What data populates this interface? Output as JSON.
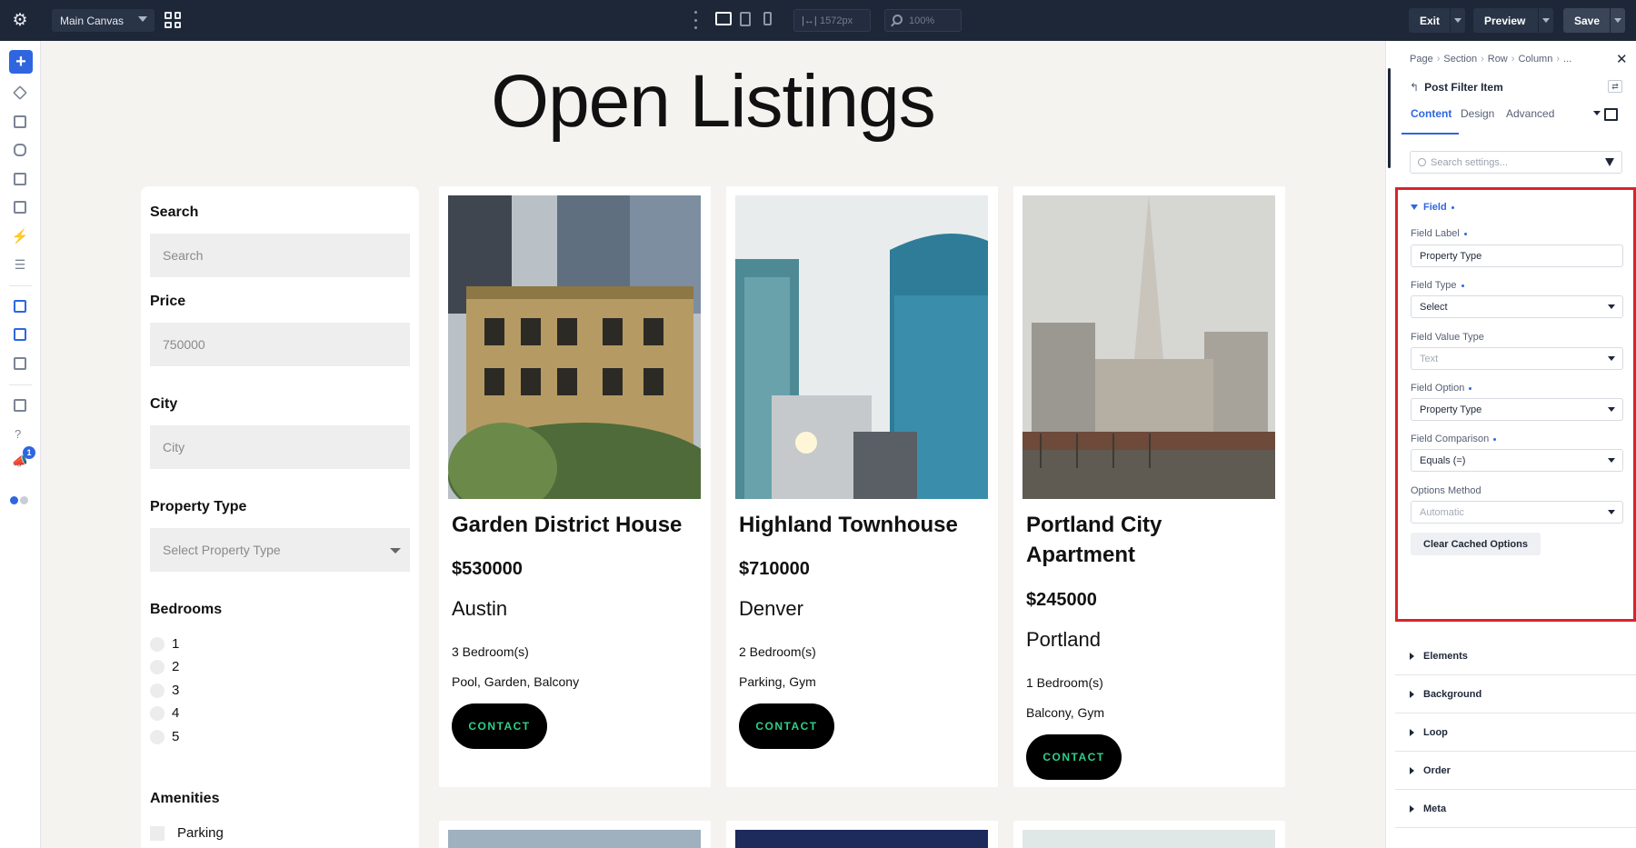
{
  "topbar": {
    "canvas_name": "Main Canvas",
    "width_value": "1572px",
    "zoom_value": "100%",
    "exit_label": "Exit",
    "preview_label": "Preview",
    "save_label": "Save"
  },
  "leftrail": {
    "badge_count": "1",
    "help_glyph": "?"
  },
  "canvas": {
    "page_title": "Open Listings",
    "filters": {
      "search_label": "Search",
      "search_placeholder": "Search",
      "price_label": "Price",
      "price_value": "750000",
      "city_label": "City",
      "city_placeholder": "City",
      "property_type_label": "Property Type",
      "property_type_placeholder": "Select Property Type",
      "bedrooms_label": "Bedrooms",
      "bedroom_options": [
        "1",
        "2",
        "3",
        "4",
        "5"
      ],
      "amenities_label": "Amenities",
      "amenity_options": [
        "Parking"
      ]
    },
    "listings": [
      {
        "name": "Garden District House",
        "price": "$530000",
        "city": "Austin",
        "bedrooms": "3 Bedroom(s)",
        "amenities": "Pool, Garden, Balcony",
        "contact_label": "CONTACT"
      },
      {
        "name": "Highland Townhouse",
        "price": "$710000",
        "city": "Denver",
        "bedrooms": "2 Bedroom(s)",
        "amenities": "Parking, Gym",
        "contact_label": "CONTACT"
      },
      {
        "name": "Portland City Apartment",
        "price": "$245000",
        "city": "Portland",
        "bedrooms": "1 Bedroom(s)",
        "amenities": "Balcony, Gym",
        "contact_label": "CONTACT"
      }
    ]
  },
  "panel": {
    "breadcrumbs": [
      "Page",
      "Section",
      "Row",
      "Column",
      "..."
    ],
    "element_title": "Post Filter Item",
    "tabs": [
      "Content",
      "Design",
      "Advanced"
    ],
    "search_placeholder": "Search settings...",
    "field_section": {
      "title": "Field",
      "field_label_label": "Field Label",
      "field_label_value": "Property Type",
      "field_type_label": "Field Type",
      "field_type_value": "Select",
      "field_value_type_label": "Field Value Type",
      "field_value_type_value": "Text",
      "field_option_label": "Field Option",
      "field_option_value": "Property Type",
      "field_comparison_label": "Field Comparison",
      "field_comparison_value": "Equals (=)",
      "options_method_label": "Options Method",
      "options_method_value": "Automatic",
      "clear_button_label": "Clear Cached Options"
    },
    "sections": [
      "Elements",
      "Background",
      "Loop",
      "Order",
      "Meta"
    ]
  },
  "colors": {
    "topbar_bg": "#1e2738",
    "accent_blue": "#2f66e0",
    "highlight_red": "#d8242d",
    "contact_text": "#2ecf8a",
    "canvas_bg": "#f4f3f0"
  }
}
